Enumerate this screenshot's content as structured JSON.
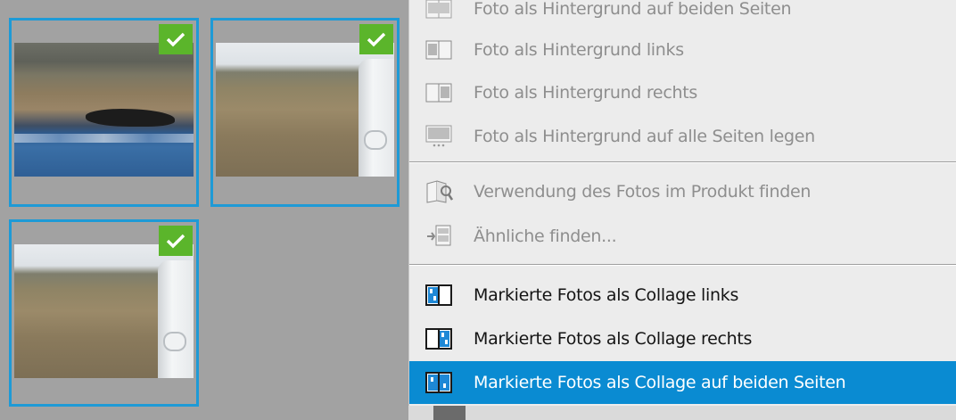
{
  "thumbnails": [
    {
      "name": "coast-photo",
      "selected": true
    },
    {
      "name": "dirt-track-photo",
      "selected": true
    },
    {
      "name": "dirt-track-photo",
      "selected": true
    }
  ],
  "colors": {
    "selection_border": "#1e9ad6",
    "checkmark_bg": "#5bb52b",
    "menu_highlight": "#0a8bd2",
    "menu_bg": "#ececec",
    "panel_bg": "#a2a2a2"
  },
  "menu": {
    "items": [
      {
        "label": "Foto als Hintergrund auf beiden Seiten",
        "icon": "background-both-icon",
        "enabled": false
      },
      {
        "label": "Foto als Hintergrund links",
        "icon": "background-left-icon",
        "enabled": false
      },
      {
        "label": "Foto als Hintergrund rechts",
        "icon": "background-right-icon",
        "enabled": false
      },
      {
        "label": "Foto als Hintergrund auf alle Seiten legen",
        "icon": "background-all-pages-icon",
        "enabled": false
      },
      {
        "label": "Verwendung des Fotos im Produkt finden",
        "icon": "find-usage-icon",
        "enabled": false
      },
      {
        "label": "Ähnliche finden...",
        "icon": "find-similar-icon",
        "enabled": false
      },
      {
        "label": "Markierte Fotos als Collage links",
        "icon": "collage-left-icon",
        "enabled": true
      },
      {
        "label": "Markierte Fotos als Collage rechts",
        "icon": "collage-right-icon",
        "enabled": true
      },
      {
        "label": "Markierte Fotos als Collage auf beiden Seiten",
        "icon": "collage-both-icon",
        "enabled": true,
        "highlighted": true
      }
    ]
  }
}
